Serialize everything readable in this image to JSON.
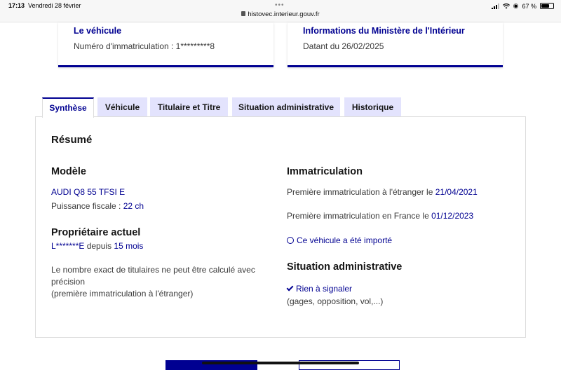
{
  "status_bar": {
    "time": "17:13",
    "date": "Vendredi 28 février",
    "url": "histovec.interieur.gouv.fr",
    "battery": "67 %",
    "battery_level": 0.67
  },
  "cards": {
    "vehicle": {
      "title": "Le véhicule",
      "text": "Numéro d'immatriculation : 1*********8"
    },
    "ministry": {
      "title": "Informations du Ministère de l'Intérieur",
      "text": "Datant du 26/02/2025"
    }
  },
  "tabs": [
    {
      "label": "Synthèse",
      "active": true
    },
    {
      "label": "Véhicule",
      "active": false
    },
    {
      "label": "Titulaire et Titre",
      "active": false
    },
    {
      "label": "Situation administrative",
      "active": false
    },
    {
      "label": "Historique",
      "active": false
    }
  ],
  "summary": {
    "title": "Résumé",
    "model": {
      "heading": "Modèle",
      "name": "AUDI Q8 55 TFSI E",
      "power_label": "Puissance fiscale : ",
      "power_value": "22 ch"
    },
    "owner": {
      "heading": "Propriétaire actuel",
      "name": "L*******E",
      "since_label": " depuis ",
      "since_value": "15 mois",
      "note_line1": "Le nombre exact de titulaires ne peut être calculé avec",
      "note_line2": "précision",
      "note_line3": "(première immatriculation à l'étranger)"
    },
    "registration": {
      "heading": "Immatriculation",
      "foreign_label": "Première immatriculation à l'étranger le ",
      "foreign_date": "21/04/2021",
      "france_label": "Première immatriculation en France le ",
      "france_date": "01/12/2023",
      "imported": "Ce véhicule a été importé"
    },
    "admin": {
      "heading": "Situation administrative",
      "status": "Rien à signaler",
      "details": "(gages, opposition, vol,...)"
    }
  },
  "colors": {
    "primary": "#000091",
    "tab_inactive": "#e3e3fd"
  }
}
